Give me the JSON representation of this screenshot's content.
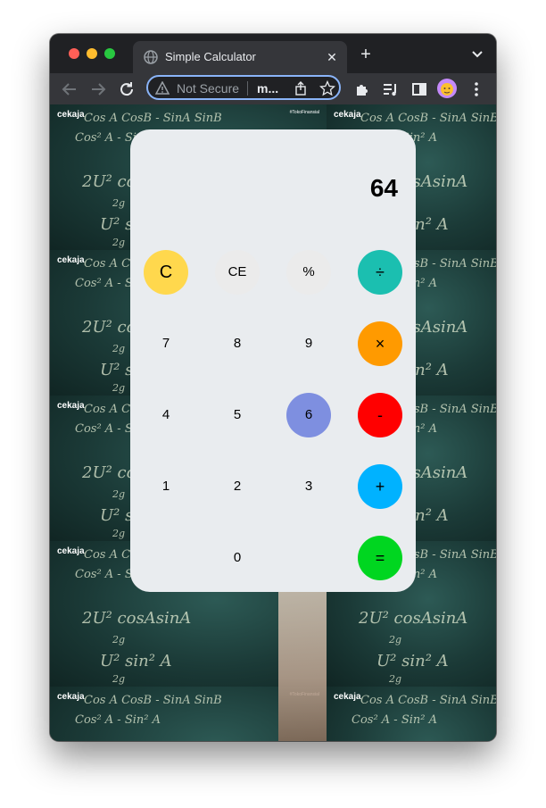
{
  "browser": {
    "tab_title": "Simple Calculator",
    "tab_close": "✕",
    "new_tab": "+",
    "omnibox": {
      "security_label": "Not Secure",
      "url": "m..."
    }
  },
  "background": {
    "logo": "cekaja",
    "tag": "#TokoFinansial",
    "formulas": [
      "Cos A CosB - SinA SinB",
      "Cos² A - Sin² A",
      "2U² cosAsinA",
      "2g",
      "U² sin² A",
      "2g"
    ]
  },
  "calculator": {
    "display": "64",
    "keys": {
      "clear": "C",
      "clear_entry": "CE",
      "percent": "%",
      "divide": "÷",
      "seven": "7",
      "eight": "8",
      "nine": "9",
      "multiply": "×",
      "four": "4",
      "five": "5",
      "six": "6",
      "subtract": "-",
      "one": "1",
      "two": "2",
      "three": "3",
      "add": "+",
      "zero": "0",
      "equals": "="
    },
    "colors": {
      "panel": "#e9ecef",
      "clear": "#ffd84d",
      "neutral_key": "#ebebeb",
      "divide": "#1bbfb0",
      "multiply": "#ff9a00",
      "subtract": "#ff0000",
      "add": "#00b2ff",
      "equals": "#00d620",
      "active_key": "#7e8fe0"
    }
  }
}
